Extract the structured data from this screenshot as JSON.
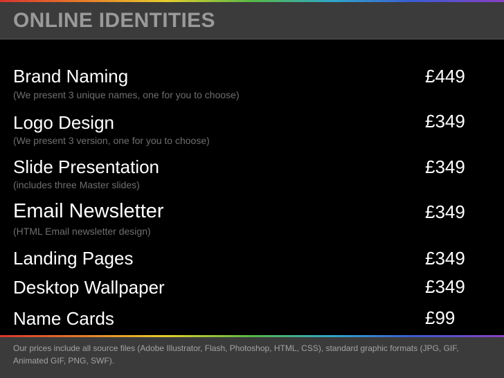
{
  "header": {
    "title": "ONLINE IDENTITIES"
  },
  "items": [
    {
      "name": "Brand Naming",
      "price": "£449",
      "note": "(We present 3 unique names, one for you to choose)"
    },
    {
      "name": "Logo Design",
      "price": "£349",
      "note": "(We present 3 version, one for you to choose)"
    },
    {
      "name": "Slide Presentation",
      "price": "£349",
      "note": "(includes three Master slides)"
    },
    {
      "name": "Email Newsletter",
      "price": "£349",
      "note": "(HTML Email newsletter design)"
    },
    {
      "name": "Landing Pages",
      "price": "£349"
    },
    {
      "name": "Desktop Wallpaper",
      "price": "£349"
    },
    {
      "name": "Name Cards",
      "price": "£99"
    }
  ],
  "footer": {
    "text": "Our prices include all source files (Adobe Illustrator, Flash, Photoshop, HTML, CSS), standard graphic formats (JPG, GIF, Animated GIF, PNG, SWF)."
  },
  "colors": {
    "background": "#000000",
    "header_bg": "#3b3b3b",
    "header_text": "#9a9a9a",
    "item_text": "#ffffff",
    "note_text": "#6f6f6f",
    "footer_text": "#a3a3a3"
  }
}
